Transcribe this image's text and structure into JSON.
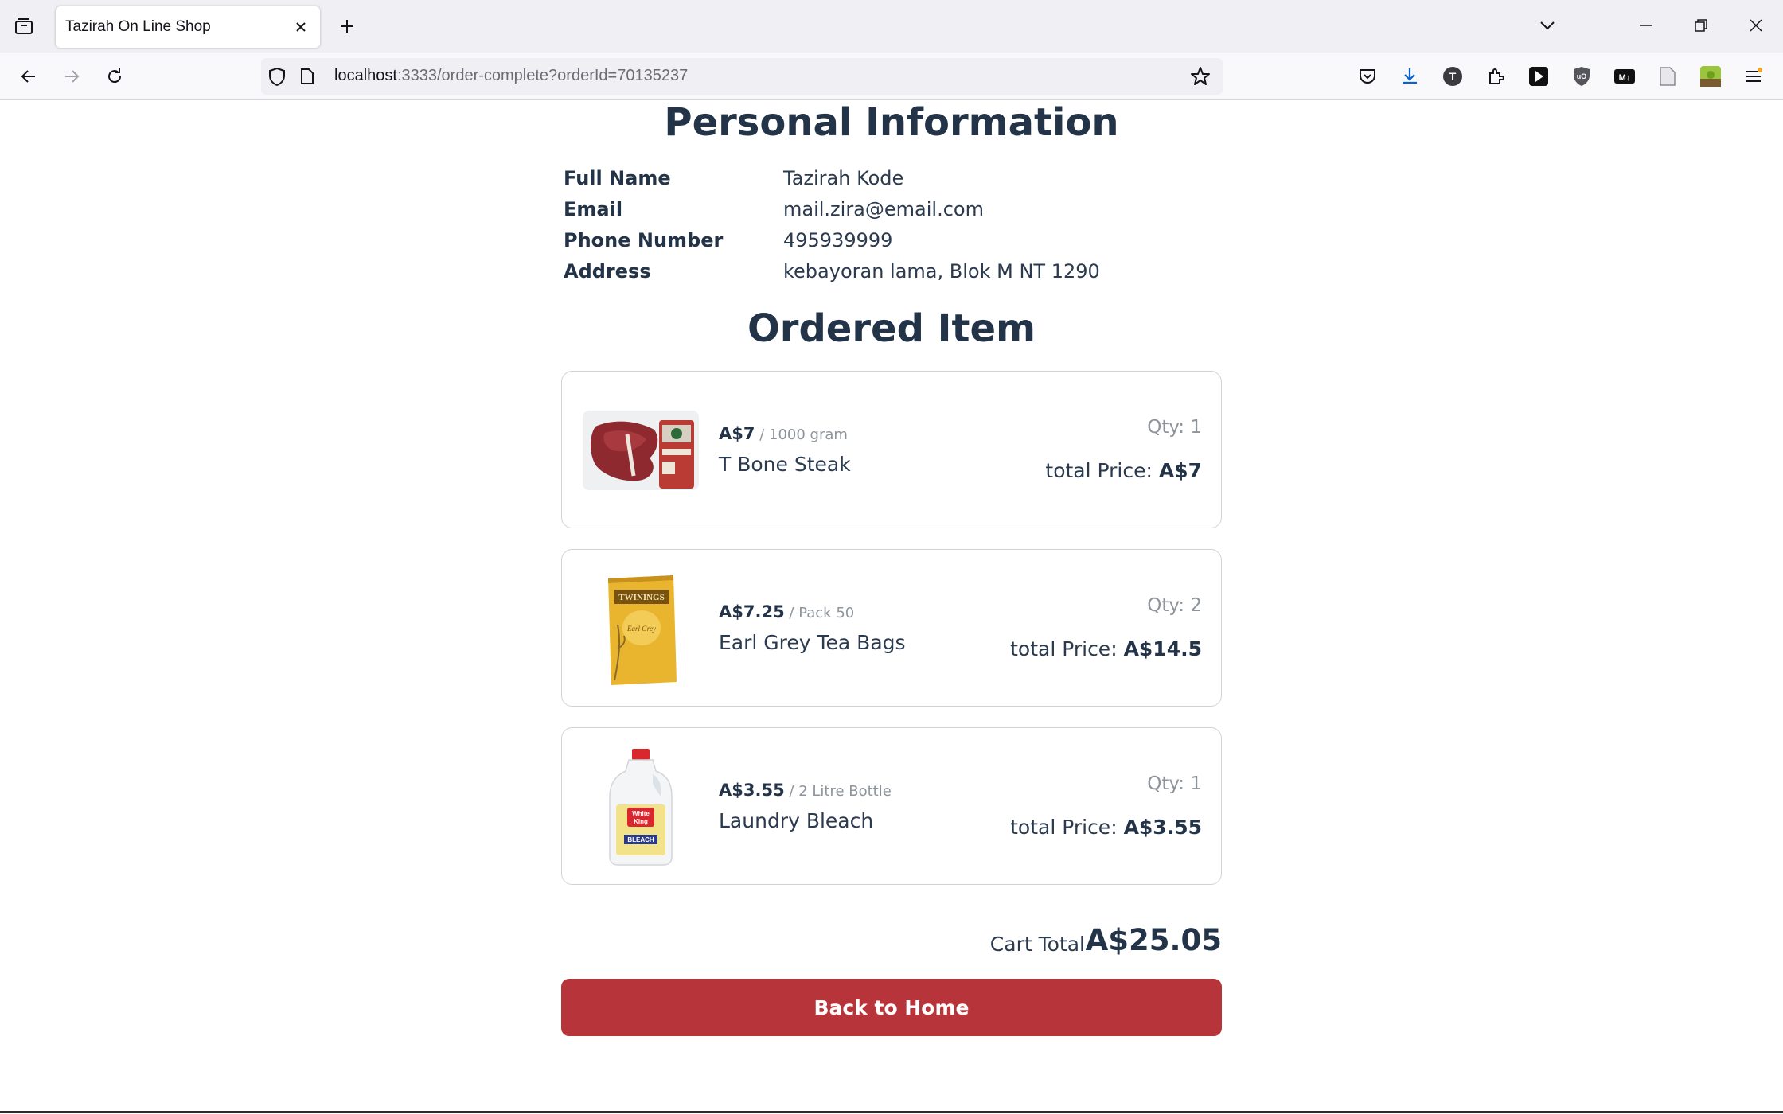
{
  "browser": {
    "tab_title": "Tazirah On Line Shop",
    "url_host": "localhost",
    "url_rest": ":3333/order-complete?orderId=70135237",
    "icons": [
      "tab-list-icon",
      "close-icon",
      "plus-icon",
      "chevron-down-icon",
      "minimize-icon",
      "restore-icon",
      "close-window-icon",
      "back-icon",
      "forward-icon",
      "reload-icon",
      "shield-icon",
      "page-icon",
      "star-icon",
      "pocket-icon",
      "download-icon",
      "extension-t-icon",
      "extensions-icon",
      "play-icon",
      "ublock-icon",
      "markdown-icon",
      "reader-icon",
      "avatar-icon",
      "menu-icon"
    ]
  },
  "personal": {
    "title": "Personal Information",
    "rows": [
      {
        "label": "Full Name",
        "value": "Tazirah Kode"
      },
      {
        "label": "Email",
        "value": "mail.zira@email.com"
      },
      {
        "label": "Phone Number",
        "value": "495939999"
      },
      {
        "label": "Address",
        "value": "kebayoran lama, Blok M NT 1290"
      }
    ]
  },
  "ordered": {
    "title": "Ordered Item",
    "items": [
      {
        "price": "A$7",
        "unit": " / 1000 gram",
        "name": "T Bone Steak",
        "qty": "Qty: 1",
        "total_label": "total Price: ",
        "total": "A$7",
        "image": "steak-image"
      },
      {
        "price": "A$7.25",
        "unit": " / Pack 50",
        "name": "Earl Grey Tea Bags",
        "qty": "Qty: 2",
        "total_label": "total Price: ",
        "total": "A$14.5",
        "image": "tea-box-image"
      },
      {
        "price": "A$3.55",
        "unit": " / 2 Litre Bottle",
        "name": "Laundry Bleach",
        "qty": "Qty: 1",
        "total_label": "total Price: ",
        "total": "A$3.55",
        "image": "bleach-bottle-image"
      }
    ]
  },
  "cart": {
    "label": "Cart Total",
    "total": "A$25.05"
  },
  "button": {
    "label": "Back to Home"
  },
  "colors": {
    "accent": "#b6343a",
    "heading": "#243448",
    "muted": "#8e949b"
  }
}
